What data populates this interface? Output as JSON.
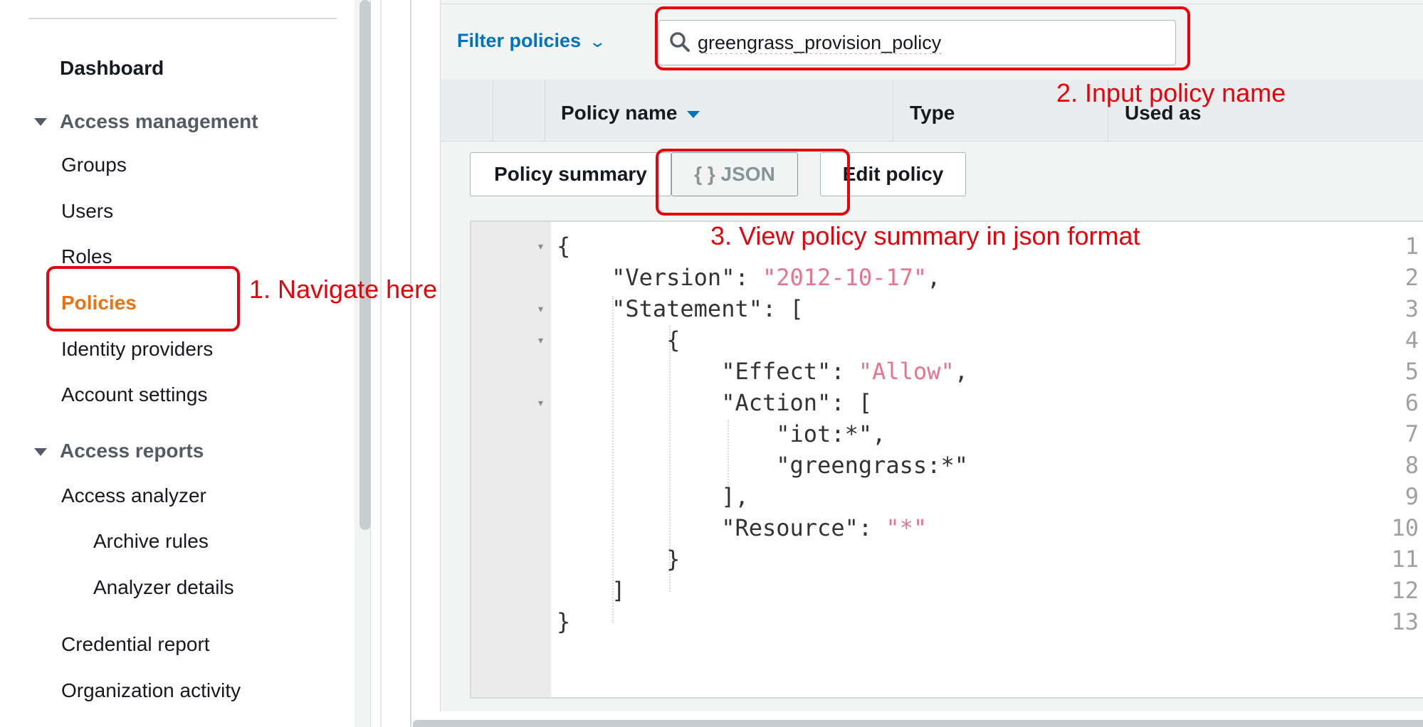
{
  "sidebar": {
    "dashboard": "Dashboard",
    "access_management": {
      "label": "Access management",
      "items": [
        "Groups",
        "Users",
        "Roles",
        "Policies",
        "Identity providers",
        "Account settings"
      ],
      "active": "Policies"
    },
    "access_reports": {
      "label": "Access reports",
      "items": [
        "Access analyzer",
        "Archive rules",
        "Analyzer details",
        "Credential report",
        "Organization activity"
      ]
    }
  },
  "filter": {
    "dropdown_label": "Filter policies",
    "search_value": "greengrass_provision_policy"
  },
  "table": {
    "columns": [
      "Policy name",
      "Type",
      "Used as"
    ]
  },
  "tabs": {
    "summary": "Policy summary",
    "json": "{ } JSON",
    "edit": "Edit policy",
    "selected": "{ } JSON"
  },
  "editor": {
    "line_numbers": [
      "1",
      "2",
      "3",
      "4",
      "5",
      "6",
      "7",
      "8",
      "9",
      "10",
      "11",
      "12",
      "13"
    ],
    "lines": [
      "{",
      "    \"Version\": \"2012-10-17\",",
      "    \"Statement\": [",
      "        {",
      "            \"Effect\": \"Allow\",",
      "            \"Action\": [",
      "                \"iot:*\",",
      "                \"greengrass:*\"",
      "            ],",
      "            \"Resource\": \"*\"",
      "        }",
      "    ]",
      "}"
    ]
  },
  "annotations": {
    "step1": "1. Navigate here",
    "step2": "2. Input policy name",
    "step3": "3. View policy summary in json format"
  },
  "colors": {
    "link_blue": "#0073bb",
    "active_orange": "#ec7211",
    "annotation_red": "#e8000b",
    "json_string": "#e8738c"
  }
}
